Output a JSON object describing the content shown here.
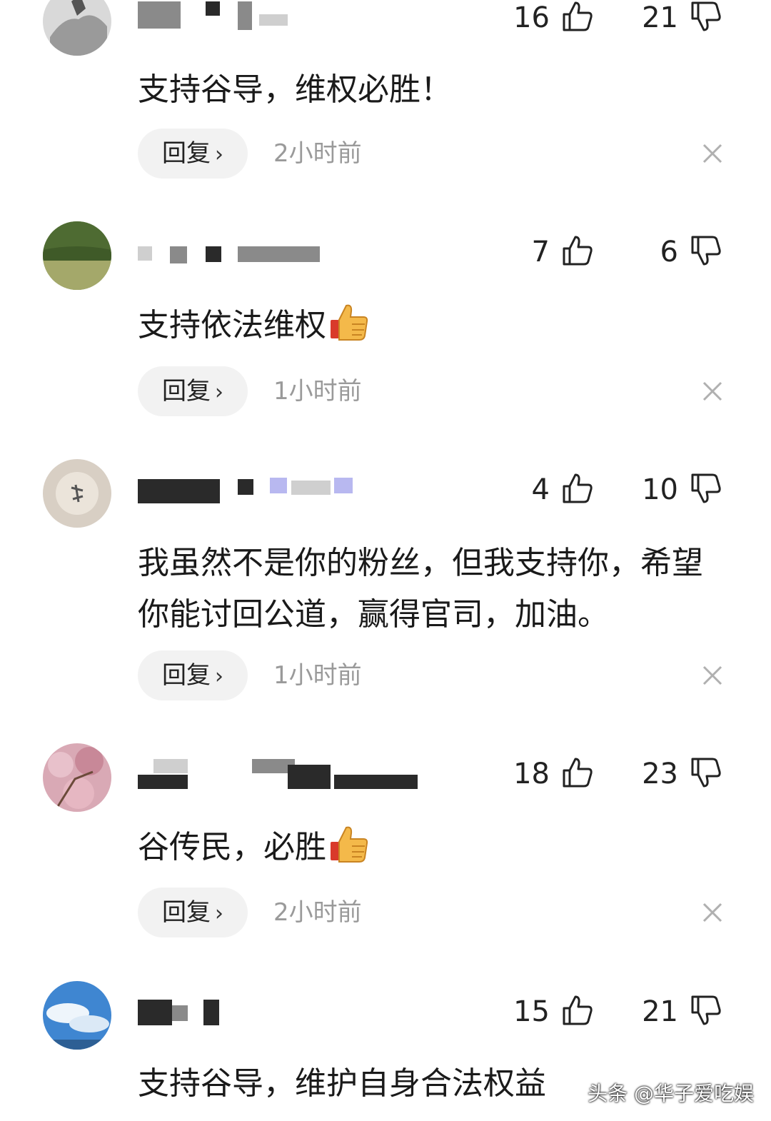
{
  "comments": [
    {
      "username": "",
      "like_count": "16",
      "dislike_count": "21",
      "text": "支持谷导，维权必胜！",
      "has_emoji": false,
      "reply_label": "回复",
      "time": "2小时前"
    },
    {
      "username": "",
      "like_count": "7",
      "dislike_count": "6",
      "text": "支持依法维权",
      "has_emoji": true,
      "reply_label": "回复",
      "time": "1小时前"
    },
    {
      "username": "",
      "like_count": "4",
      "dislike_count": "10",
      "text": "我虽然不是你的粉丝，但我支持你，希望你能讨回公道，赢得官司，加油。",
      "has_emoji": false,
      "reply_label": "回复",
      "time": "1小时前"
    },
    {
      "username": "",
      "like_count": "18",
      "dislike_count": "23",
      "text": "谷传民，必胜",
      "has_emoji": true,
      "reply_label": "回复",
      "time": "2小时前"
    },
    {
      "username": "",
      "like_count": "15",
      "dislike_count": "21",
      "text": "支持谷导，维护自身合法权益",
      "has_emoji": false
    }
  ],
  "icons": {
    "like": "thumbs-up-outline-icon",
    "dislike": "thumbs-down-outline-icon",
    "emoji": "thumbs-up-emoji",
    "close": "close-icon",
    "chevron": "chevron-right-icon"
  },
  "watermark": "头条 @华子爱吃娱"
}
